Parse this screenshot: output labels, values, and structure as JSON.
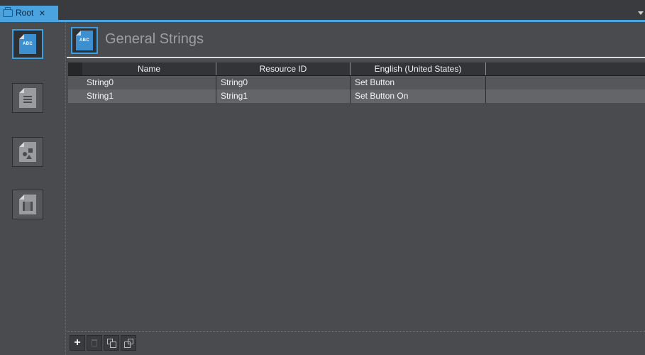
{
  "tab": {
    "label": "Root",
    "close": "×"
  },
  "sidebar": {
    "items": [
      {
        "icon": "abc-document-icon",
        "glyph": "ABC",
        "active": true
      },
      {
        "icon": "list-document-icon",
        "active": false
      },
      {
        "icon": "shapes-document-icon",
        "active": false
      },
      {
        "icon": "film-document-icon",
        "active": false
      }
    ]
  },
  "header": {
    "title": "General Strings",
    "icon_glyph": "ABC"
  },
  "table": {
    "columns": [
      "Name",
      "Resource ID",
      "English (United States)"
    ],
    "rows": [
      {
        "name": "String0",
        "resource_id": "String0",
        "english": "Set Button"
      },
      {
        "name": "String1",
        "resource_id": "String1",
        "english": "Set Button On"
      }
    ]
  },
  "toolbar": {
    "add": "+",
    "buttons": [
      "add-button",
      "delete-button",
      "copy-button",
      "paste-button"
    ]
  },
  "colors": {
    "accent": "#3aa0e3",
    "tab": "#4aa3df",
    "background": "#4a4b4f"
  }
}
